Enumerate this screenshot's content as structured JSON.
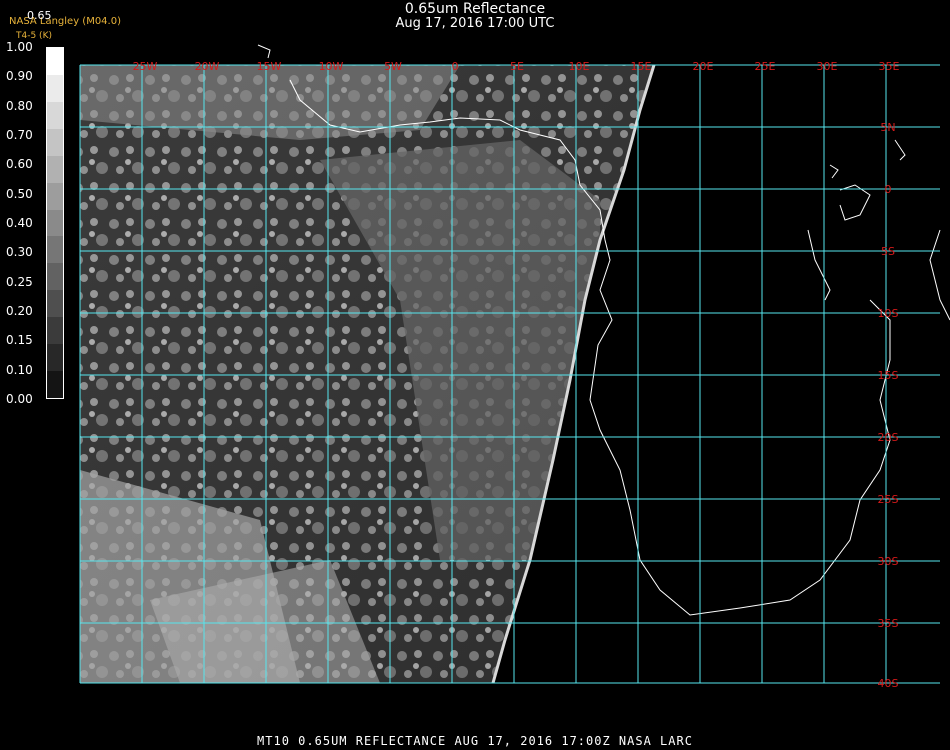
{
  "header": {
    "title": "0.65um Reflectance",
    "subtitle": "Aug 17, 2016 17:00 UTC",
    "agency": "NASA Langley (M04.0)",
    "channel": "T4-5 (K)",
    "scale_top": "0.65"
  },
  "colorbar": {
    "labels": [
      "1.00",
      "0.90",
      "0.80",
      "0.70",
      "0.60",
      "0.50",
      "0.40",
      "0.30",
      "0.25",
      "0.20",
      "0.15",
      "0.10",
      "0.00"
    ]
  },
  "map": {
    "lon_labels": [
      "25W",
      "20W",
      "15W",
      "10W",
      "5W",
      "0",
      "5E",
      "10E",
      "15E",
      "20E",
      "25E",
      "30E",
      "35E"
    ],
    "lat_labels": [
      "5N",
      "0",
      "5S",
      "10S",
      "15S",
      "20S",
      "25S",
      "30S",
      "35S",
      "40S"
    ],
    "grid_color": "#56e6ee",
    "label_color": "#d61a1a"
  },
  "footer": "MT10  0.65UM REFLECTANCE   AUG 17, 2016 17:00Z   NASA LARC"
}
